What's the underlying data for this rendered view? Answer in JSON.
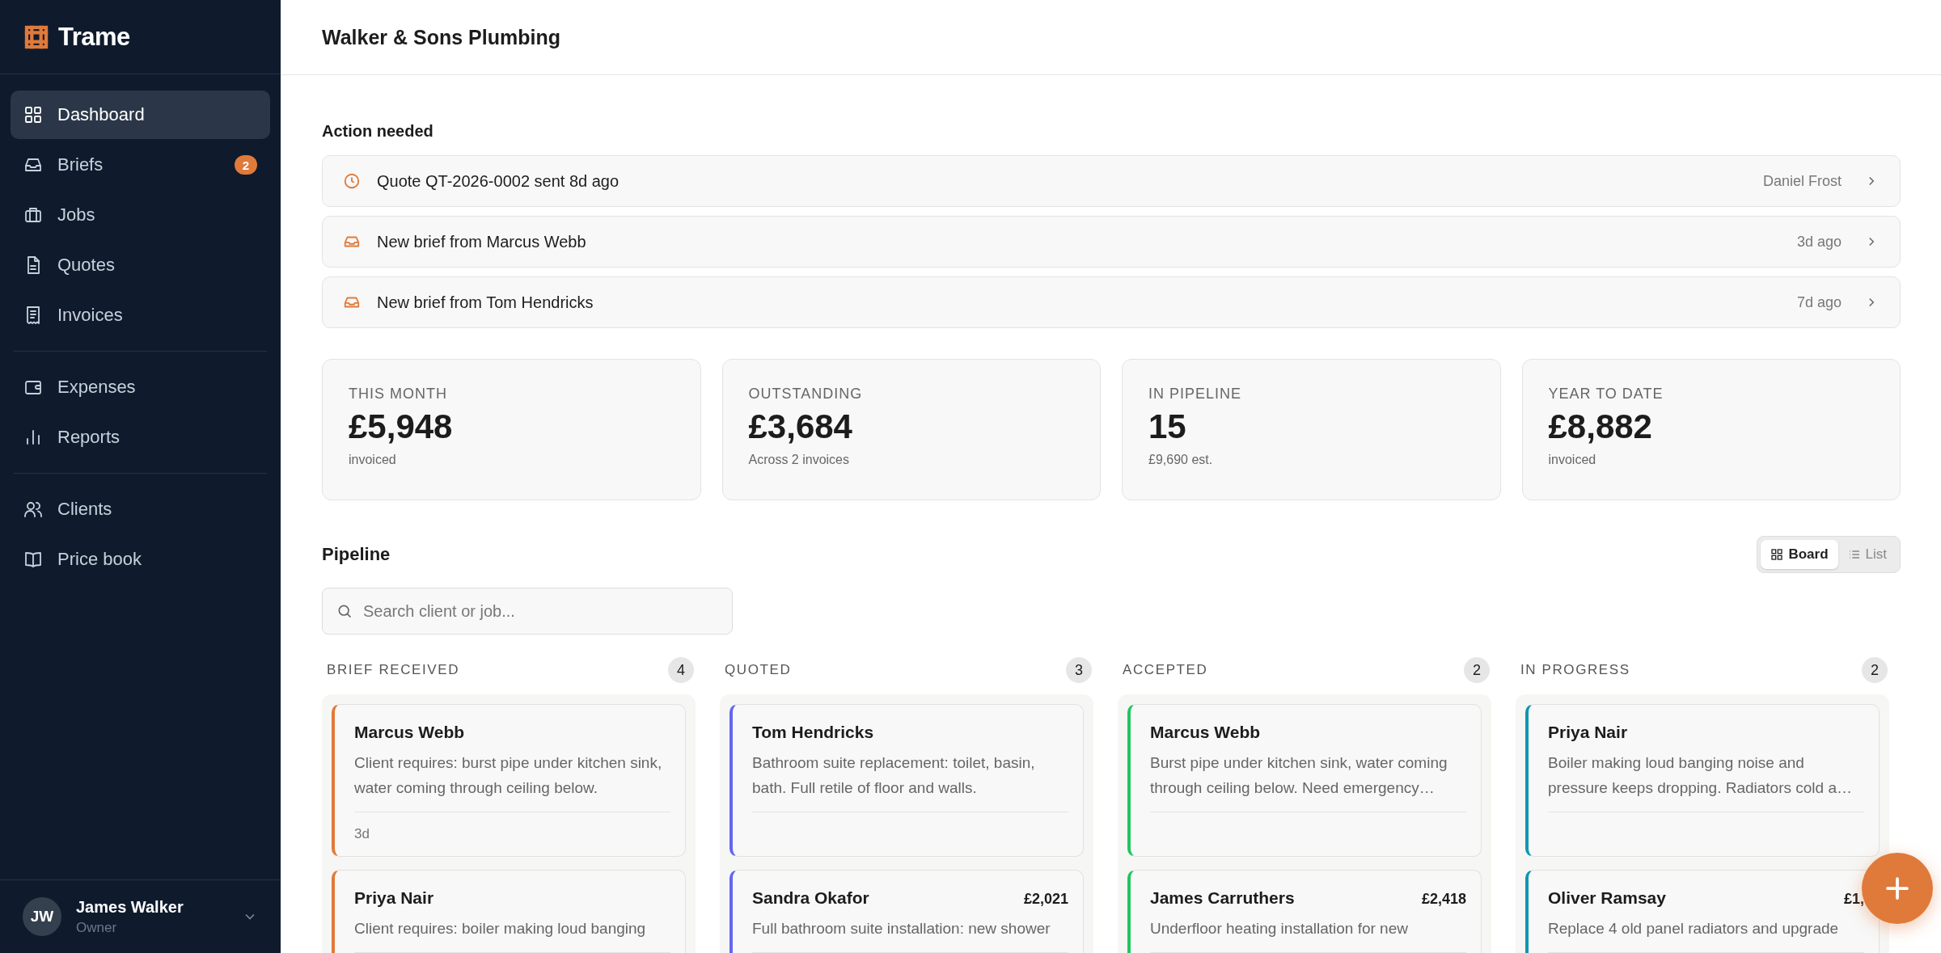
{
  "app": {
    "name": "Trame"
  },
  "sidebar": {
    "groups": [
      {
        "items": [
          {
            "label": "Dashboard",
            "selected": true
          },
          {
            "label": "Briefs",
            "selected": false,
            "badge": "2"
          },
          {
            "label": "Jobs",
            "selected": false
          },
          {
            "label": "Quotes",
            "selected": false
          },
          {
            "label": "Invoices",
            "selected": false
          }
        ]
      },
      {
        "items": [
          {
            "label": "Expenses",
            "selected": false
          },
          {
            "label": "Reports",
            "selected": false
          }
        ]
      },
      {
        "items": [
          {
            "label": "Clients",
            "selected": false
          },
          {
            "label": "Price book",
            "selected": false
          }
        ]
      }
    ],
    "user": {
      "initials": "JW",
      "name": "James Walker",
      "role": "Owner"
    }
  },
  "header": {
    "title": "Walker & Sons Plumbing"
  },
  "action_needed": {
    "title": "Action needed",
    "items": [
      {
        "kind": "quote",
        "text": "Quote QT-2026-0002 sent 8d ago",
        "meta": "Daniel Frost"
      },
      {
        "kind": "brief",
        "text": "New brief from Marcus Webb",
        "meta": "3d ago"
      },
      {
        "kind": "brief",
        "text": "New brief from Tom Hendricks",
        "meta": "7d ago"
      }
    ]
  },
  "stats": [
    {
      "label": "THIS MONTH",
      "value": "£5,948",
      "note": "invoiced"
    },
    {
      "label": "OUTSTANDING",
      "value": "£3,684",
      "note": "Across 2 invoices"
    },
    {
      "label": "IN PIPELINE",
      "value": "15",
      "note": "£9,690 est."
    },
    {
      "label": "YEAR TO DATE",
      "value": "£8,882",
      "note": "invoiced"
    }
  ],
  "pipeline": {
    "title": "Pipeline",
    "views": [
      {
        "label": "Board",
        "selected": true
      },
      {
        "label": "List",
        "selected": false
      }
    ],
    "search": {
      "placeholder": "Search client or job..."
    },
    "columns": [
      {
        "title": "BRIEF RECEIVED",
        "count": "4",
        "color": "#e07a3a",
        "cards": [
          {
            "name": "Marcus Webb",
            "description": "Client requires: burst pipe under kitchen sink, water coming through ceiling below.",
            "age": "3d"
          },
          {
            "name": "Priya Nair",
            "description": "Client requires: boiler making loud banging"
          }
        ]
      },
      {
        "title": "QUOTED",
        "count": "3",
        "color": "#6366f1",
        "cards": [
          {
            "name": "Tom Hendricks",
            "description": "Bathroom suite replacement: toilet, basin, bath. Full retile of floor and walls."
          },
          {
            "name": "Sandra Okafor",
            "amount": "£2,021",
            "description": "Full bathroom suite installation: new shower"
          }
        ]
      },
      {
        "title": "ACCEPTED",
        "count": "2",
        "color": "#22c55e",
        "cards": [
          {
            "name": "Marcus Webb",
            "description": "Burst pipe under kitchen sink, water coming through ceiling below. Need emergency…"
          },
          {
            "name": "James Carruthers",
            "amount": "£2,418",
            "description": "Underfloor heating installation for new"
          }
        ]
      },
      {
        "title": "IN PROGRESS",
        "count": "2",
        "color": "#0e97b0",
        "cards": [
          {
            "name": "Priya Nair",
            "description": "Boiler making loud banging noise and pressure keeps dropping. Radiators cold a…"
          },
          {
            "name": "Oliver Ramsay",
            "amount": "£1,",
            "description": "Replace 4 old panel radiators and upgrade"
          }
        ]
      }
    ]
  }
}
